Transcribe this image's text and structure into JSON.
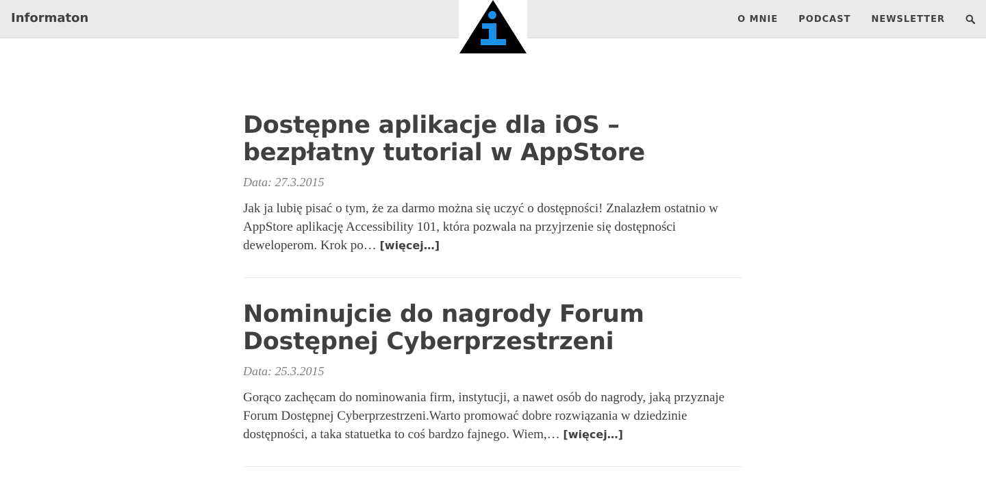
{
  "brand": "Informaton",
  "logo": {
    "icon": "info-warning-triangle-icon",
    "glyph": "i",
    "triangle_color": "#000000",
    "glyph_color": "#1a90e8"
  },
  "nav": {
    "items": [
      "O MNIE",
      "PODCAST",
      "NEWSLETTER"
    ],
    "search_icon": "search-icon"
  },
  "posts": [
    {
      "title": "Dostępne aplikacje dla iOS – bezpłatny tutorial w AppStore",
      "date": "Data: 27.3.2015",
      "excerpt": "Jak ja lubię pisać o tym, że za darmo można się uczyć o dostępności! Znalazłem ostatnio w AppStore aplikację Accessibility 101, która pozwala na przyjrzenie się dostępności deweloperom. Krok po…",
      "more": "[więcej…]"
    },
    {
      "title": "Nominujcie do nagrody Forum Dostępnej Cyberprzestrzeni",
      "date": "Data: 25.3.2015",
      "excerpt": "Gorąco zachęcam do nominowania firm, instytucji, a nawet osób do nagrody, jaką przyznaje Forum Dostępnej Cyberprzestrzeni.Warto promować dobre rozwiązania w dziedzinie dostępności, a taka statuetka to coś bardzo fajnego. Wiem,…",
      "more": "[więcej…]"
    }
  ],
  "colors": {
    "navbar_bg": "#eaeaea",
    "text": "#404040",
    "meta": "#808080",
    "accent": "#1a90e8"
  }
}
